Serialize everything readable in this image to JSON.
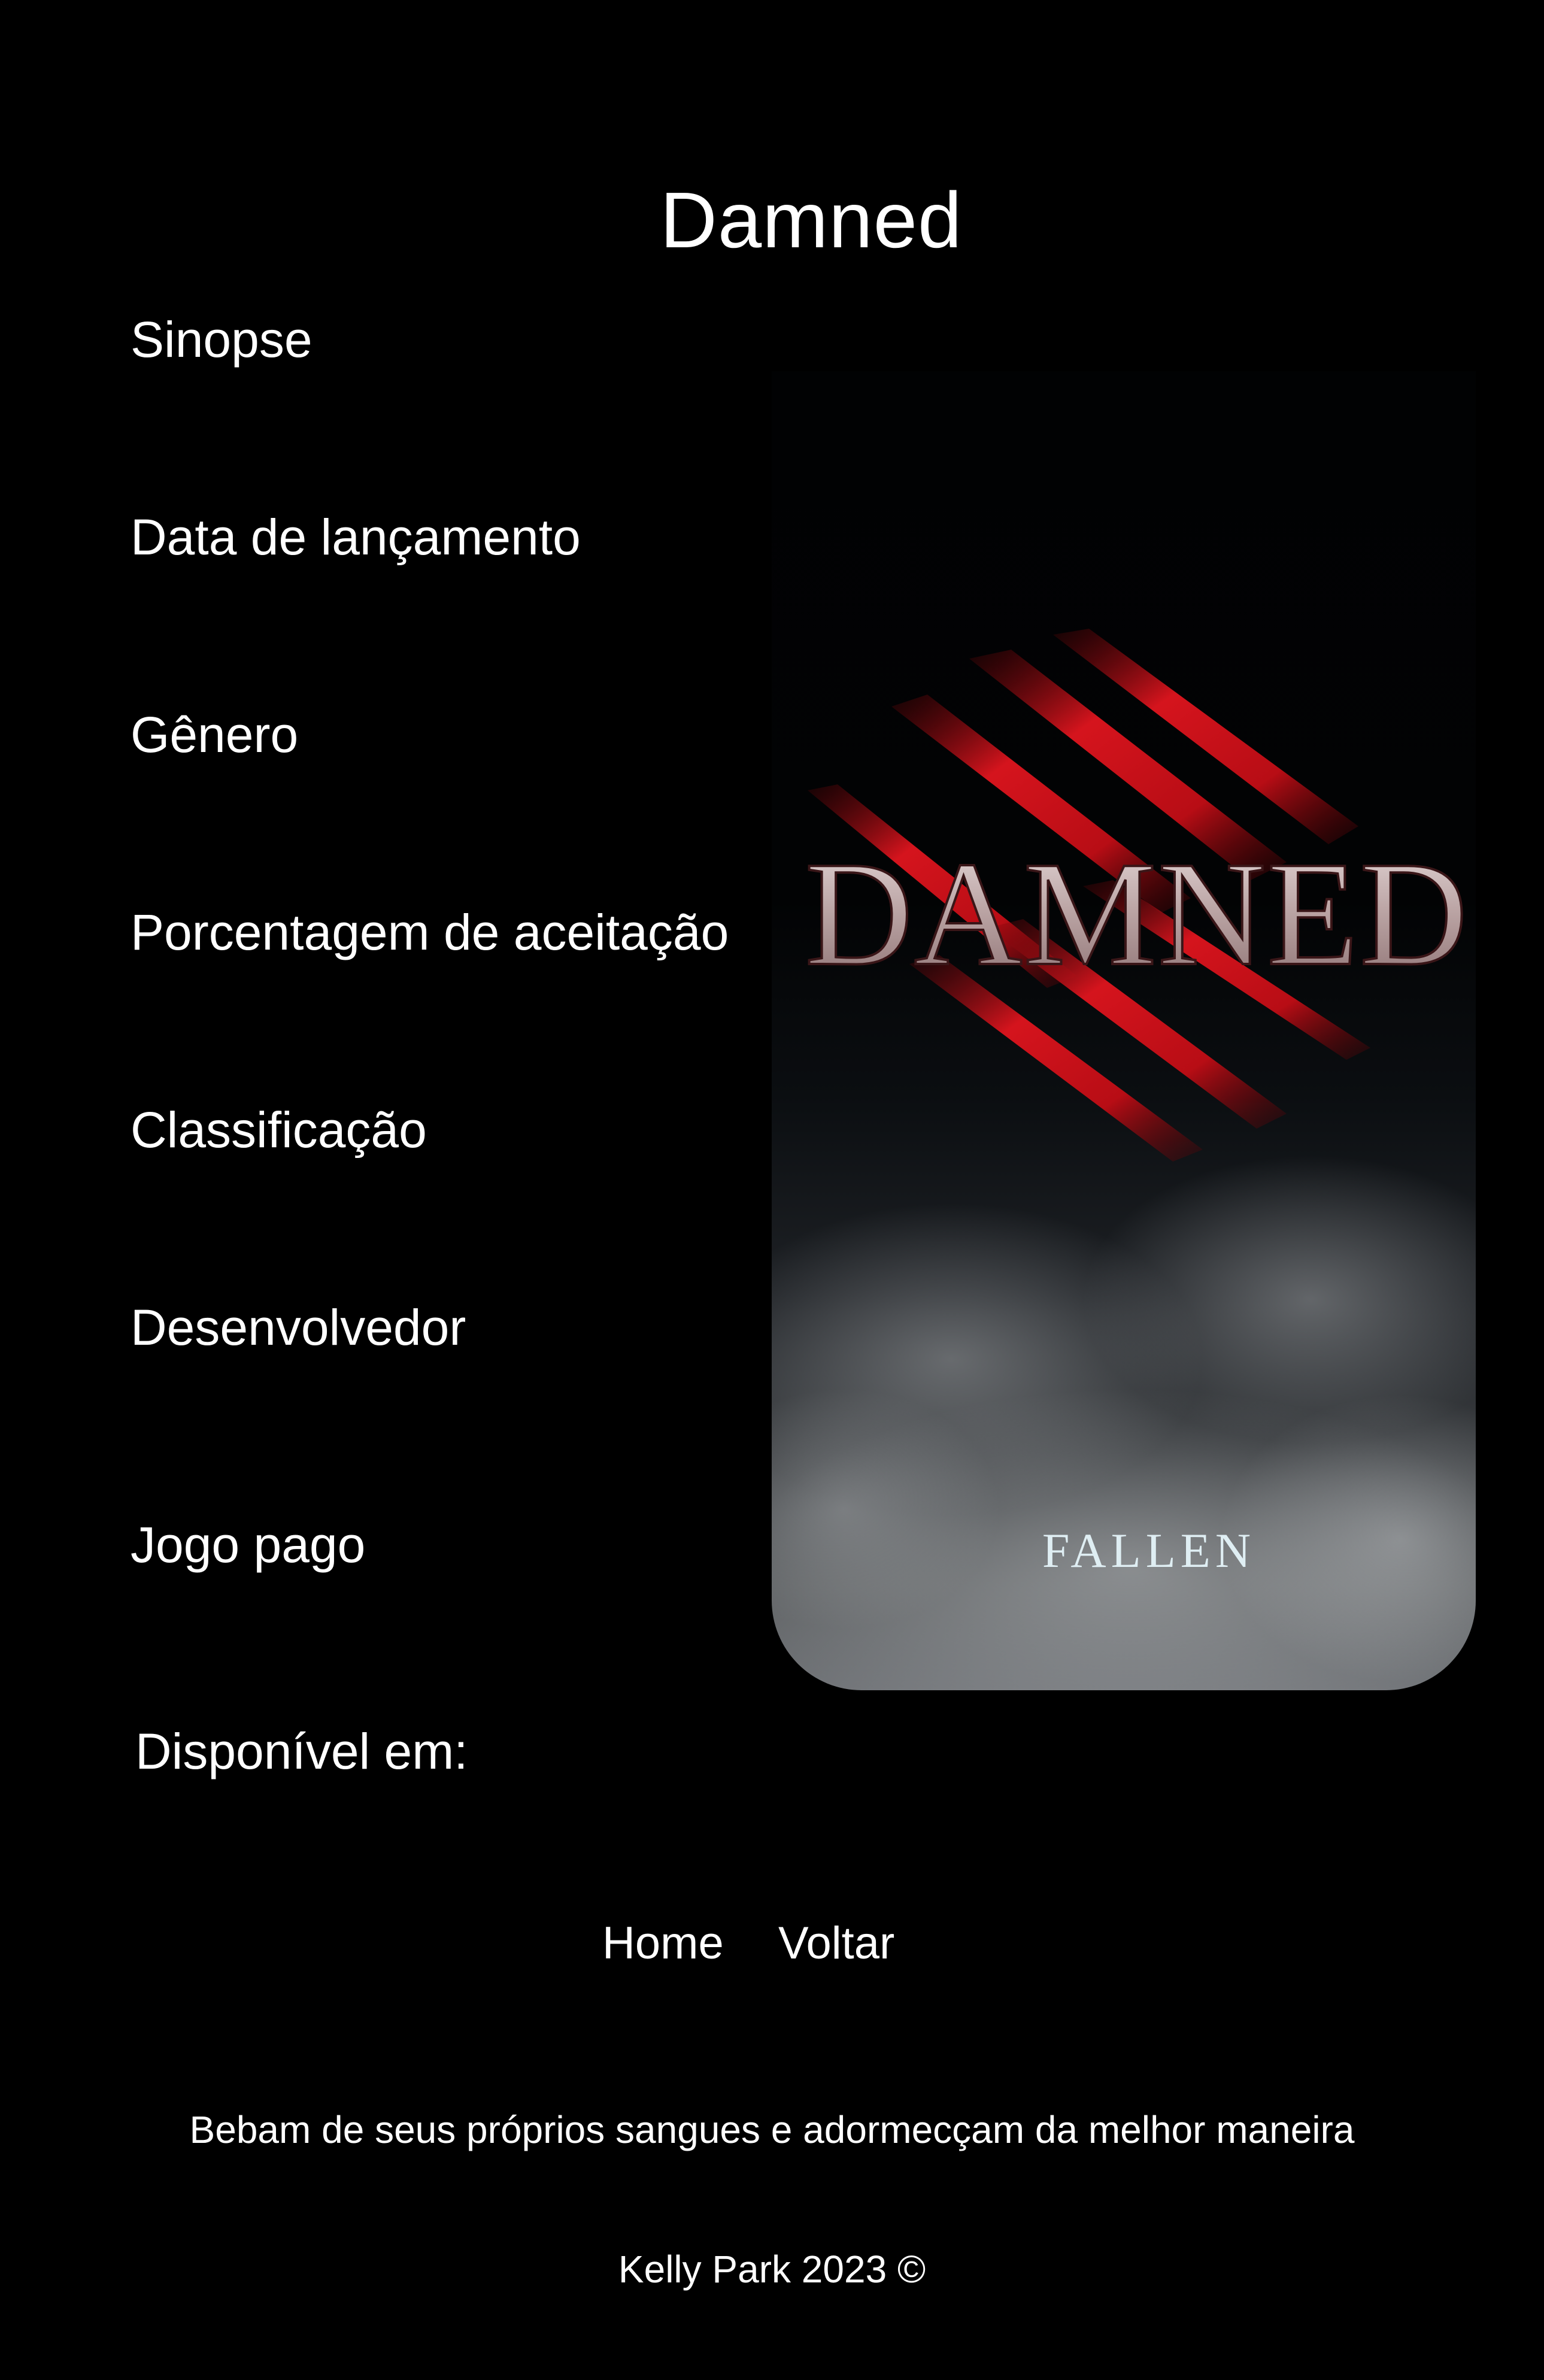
{
  "page": {
    "title": "Damned"
  },
  "info": {
    "labels": [
      "Sinopse",
      "Data de lançamento",
      "Gênero",
      "Porcentagem de aceitação",
      "Classificação",
      "Desenvolvedor",
      "Jogo pago"
    ],
    "available_label": "Disponível em:"
  },
  "cover": {
    "logo_text": "DAMNED",
    "subtitle": "FALLEN",
    "accent_color": "#c0121a"
  },
  "nav": {
    "home_label": "Home",
    "back_label": "Voltar"
  },
  "footer": {
    "quote": "Bebam de seus próprios sangues e adormecçam da melhor maneira",
    "credit": "Kelly Park 2023 ©"
  },
  "colors": {
    "background": "#000000",
    "text": "#ffffff"
  }
}
